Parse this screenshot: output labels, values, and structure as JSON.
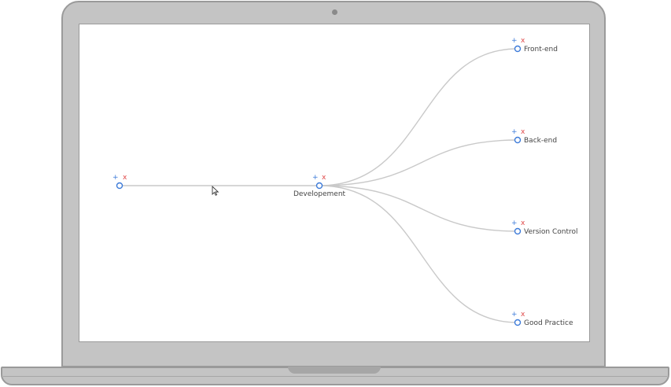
{
  "mindmap": {
    "add_symbol": "+",
    "delete_symbol": "x",
    "colors": {
      "edge": "#c9c9c9",
      "node_outline": "#3d7bd9",
      "add": "#3d7bd9",
      "delete": "#e04848",
      "label": "#444444"
    },
    "root": {
      "label": ""
    },
    "center": {
      "label": "Developement"
    },
    "children": [
      {
        "label": "Front-end"
      },
      {
        "label": "Back-end"
      },
      {
        "label": "Version Control"
      },
      {
        "label": "Good Practice"
      }
    ]
  }
}
